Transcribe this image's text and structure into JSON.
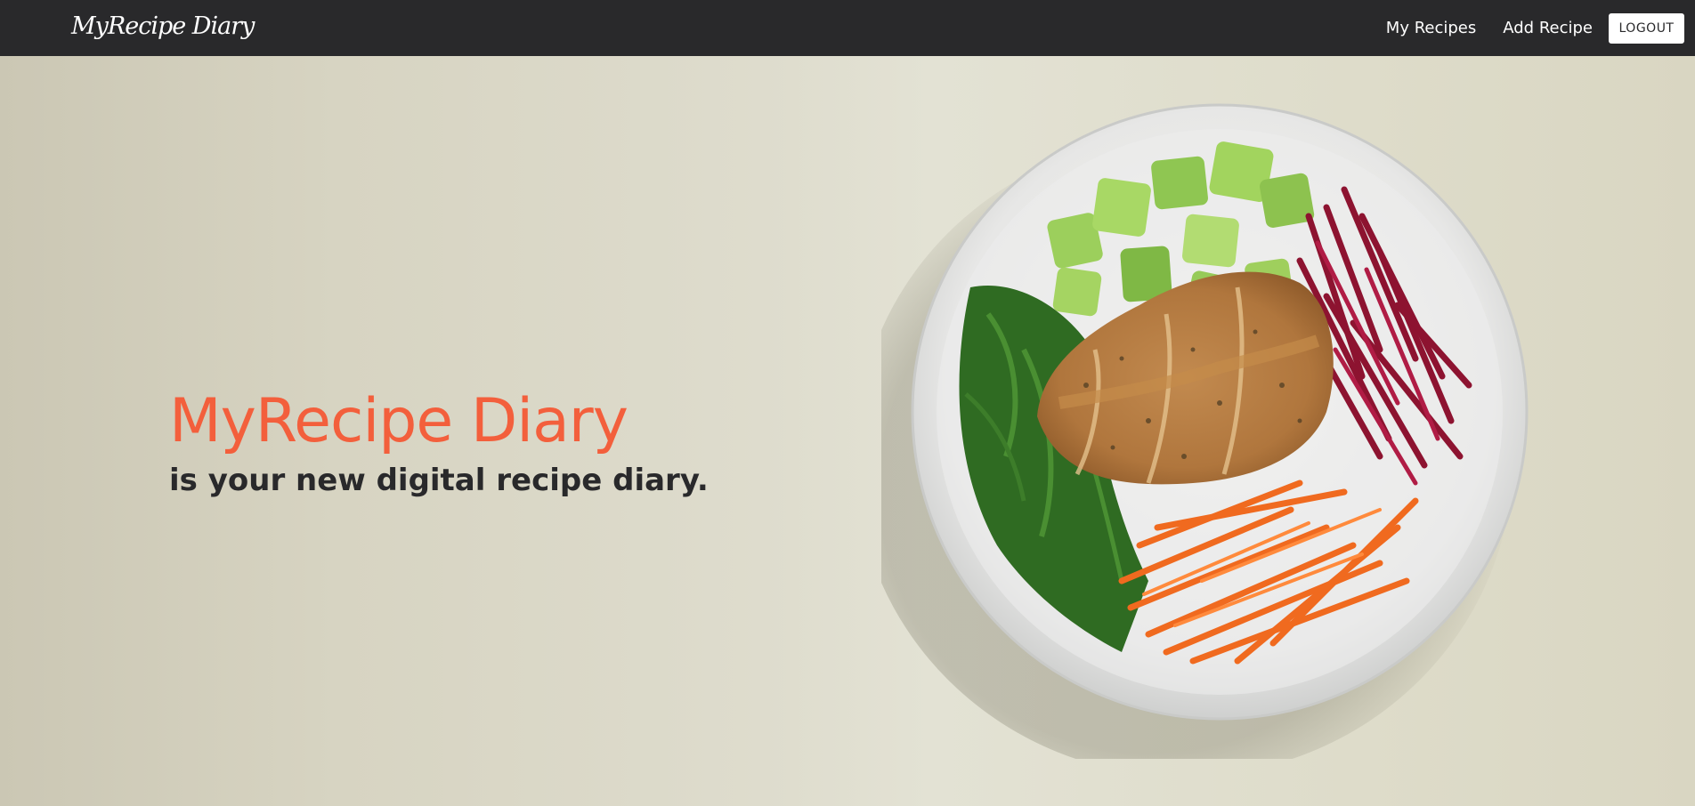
{
  "nav": {
    "brand": "MyRecipe Diary",
    "links": [
      "My Recipes",
      "Add Recipe"
    ],
    "logout_label": "LOGOUT"
  },
  "hero": {
    "title": "MyRecipe Diary",
    "subtitle": "is your new digital recipe diary."
  },
  "colors": {
    "navbar_bg": "#29292b",
    "accent": "#f35f3c",
    "text_dark": "#29292b",
    "hero_bg": "#dedccd"
  }
}
